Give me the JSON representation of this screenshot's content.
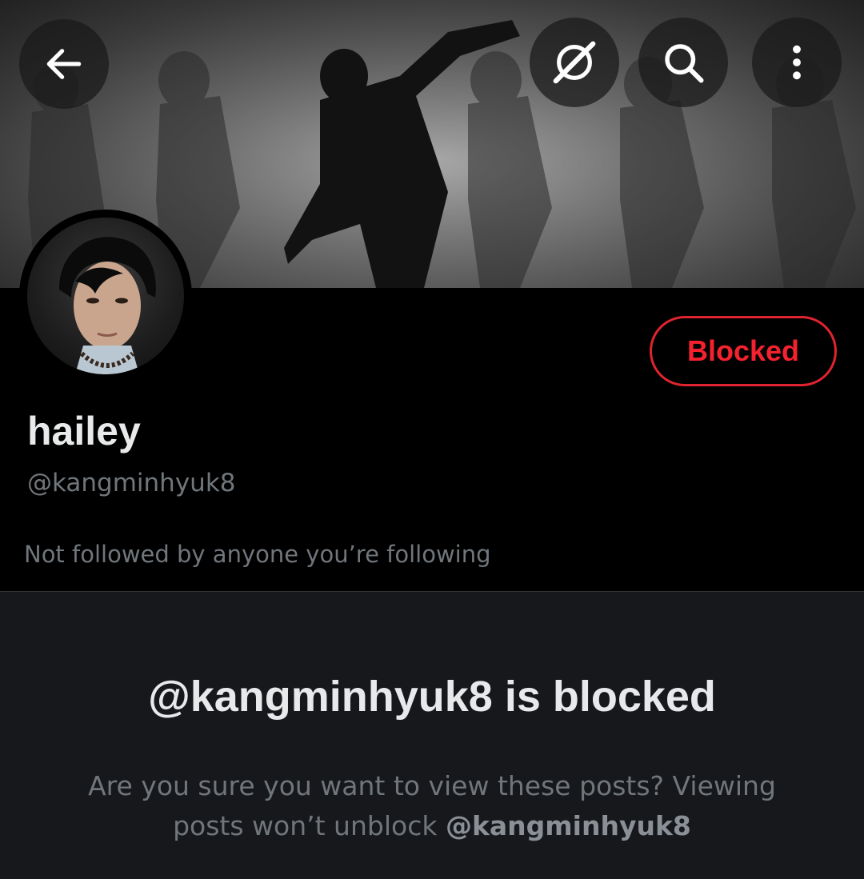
{
  "header": {
    "back_icon": "arrow-left-icon",
    "grok_icon": "grok-icon",
    "search_icon": "search-icon",
    "more_icon": "more-vertical-icon"
  },
  "profile": {
    "display_name": "hailey",
    "handle": "@kangminhyuk8",
    "followers_note": "Not followed by anyone you’re following",
    "blocked_button_label": "Blocked"
  },
  "blocked_notice": {
    "title": "@kangminhyuk8 is blocked",
    "description_prefix": "Are you sure you want to view these posts? Viewing posts won’t unblock ",
    "description_handle": "@kangminhyuk8"
  },
  "colors": {
    "blocked_red": "#f4212e",
    "secondary_text": "#71767b",
    "panel_bg": "#16181c"
  }
}
